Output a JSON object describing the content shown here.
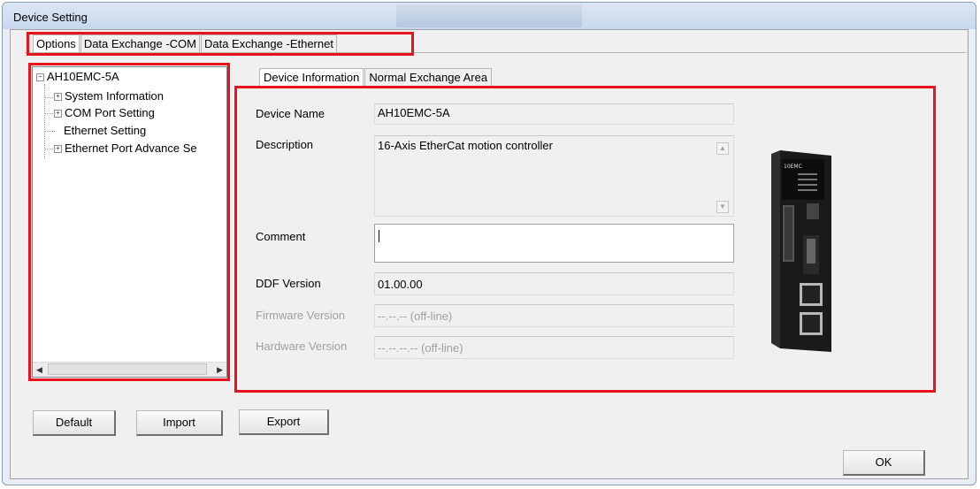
{
  "window": {
    "title": "Device Setting"
  },
  "top_tabs": [
    {
      "label": "Options",
      "active": true
    },
    {
      "label": "Data Exchange -COM",
      "active": false
    },
    {
      "label": "Data Exchange -Ethernet",
      "active": false
    }
  ],
  "tree": {
    "root": "AH10EMC-5A",
    "children": [
      {
        "label": "System Information",
        "expandable": true
      },
      {
        "label": "COM Port Setting",
        "expandable": true
      },
      {
        "label": "Ethernet Setting",
        "expandable": false
      },
      {
        "label": "Ethernet Port Advance Se",
        "expandable": true
      }
    ]
  },
  "inner_tabs": [
    {
      "label": "Device Information",
      "active": true
    },
    {
      "label": "Normal Exchange Area",
      "active": false
    }
  ],
  "fields": {
    "device_name": {
      "label": "Device Name",
      "value": "AH10EMC-5A"
    },
    "description": {
      "label": "Description",
      "value": "16-Axis EtherCat motion controller"
    },
    "comment": {
      "label": "Comment",
      "value": ""
    },
    "ddf_version": {
      "label": "DDF Version",
      "value": "01.00.00"
    },
    "firmware_version": {
      "label": "Firmware Version",
      "value": "--.--.-- (off-line)"
    },
    "hardware_version": {
      "label": "Hardware Version",
      "value": "--.--.--.-- (off-line)"
    }
  },
  "device_image": {
    "brand_label": "10EMC"
  },
  "buttons": {
    "default": "Default",
    "import": "Import",
    "export": "Export",
    "ok": "OK"
  },
  "colors": {
    "highlight": "#e8141c",
    "window_frame": "#e9eef6",
    "dialog_bg": "#f0f0f0"
  },
  "icons": {
    "tree_expand": "plus-box-icon",
    "tree_collapse": "minus-box-icon",
    "scroll_up": "triangle-up-icon",
    "scroll_down": "triangle-down-icon",
    "scroll_left": "triangle-left-icon",
    "scroll_right": "triangle-right-icon"
  }
}
